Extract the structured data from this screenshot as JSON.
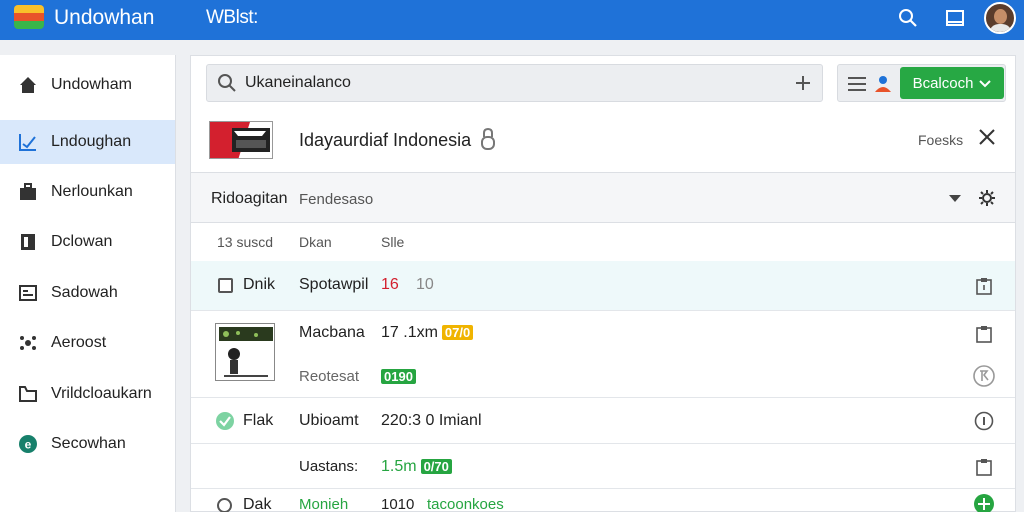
{
  "app": {
    "title": "Undowhan",
    "subtitle": "WBlst:"
  },
  "sidebar": {
    "items": [
      {
        "label": "Undowham",
        "icon": "home-icon"
      },
      {
        "label": "Lndoughan",
        "icon": "chart-check-icon",
        "active": true
      },
      {
        "label": "Nerlounkan",
        "icon": "briefcase-icon"
      },
      {
        "label": "Dclowan",
        "icon": "bookmark-icon"
      },
      {
        "label": "Sadowah",
        "icon": "window-icon"
      },
      {
        "label": "Aeroost",
        "icon": "settings-icon"
      },
      {
        "label": "Vrildcloaukarn",
        "icon": "folder-icon"
      },
      {
        "label": "Secowhan",
        "icon": "circle-e-icon"
      }
    ]
  },
  "search": {
    "value": "Ukaneinalanco"
  },
  "toolbar": {
    "green_button_label": "Bcalcoch"
  },
  "banner": {
    "title": "Idayaurdiaf Indonesia",
    "right_text": "Foesks"
  },
  "section": {
    "title": "Ridoagitan",
    "subtitle": "Fendesaso"
  },
  "table": {
    "headers": [
      "13 suscd",
      "Dkan",
      "Slle"
    ],
    "rows": [
      {
        "name": "Dnik",
        "col2": "Spotawpil",
        "value": "16",
        "extra": "10"
      },
      {
        "col2": "Macbana",
        "value": "17 .1xm",
        "badge": "07/0",
        "status_label": "Reotesat",
        "status_value": "0190"
      },
      {
        "name": "Flak",
        "col2": "Ubioamt",
        "value": "220:3 0 Imianl"
      },
      {
        "col2": "Uastans:",
        "value": "1.5m",
        "badge": "0/70"
      },
      {
        "name": "Dak",
        "col2": "Monieh",
        "value": "1010",
        "extra": "tacoonkoes"
      }
    ]
  },
  "colors": {
    "topbar": "#1f72d8",
    "accent_green": "#27a844",
    "active_nav": "#d9e8fb",
    "red_value": "#d3202e",
    "badge_yellow": "#f0b400"
  }
}
